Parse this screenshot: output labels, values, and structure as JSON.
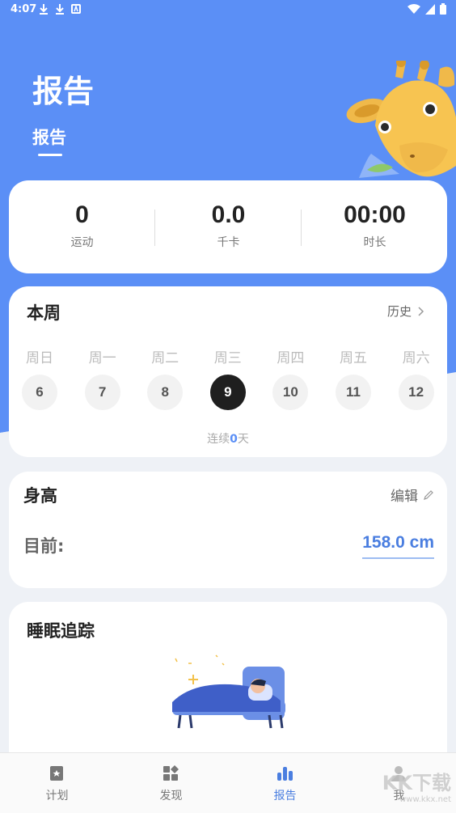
{
  "status_bar": {
    "time": "4:07"
  },
  "header": {
    "title": "报告",
    "tab": "报告"
  },
  "stats": [
    {
      "value": "0",
      "label": "运动"
    },
    {
      "value": "0.0",
      "label": "千卡"
    },
    {
      "value": "00:00",
      "label": "时长"
    }
  ],
  "week": {
    "title": "本周",
    "history_label": "历史",
    "days": [
      {
        "name": "周日",
        "date": "6"
      },
      {
        "name": "周一",
        "date": "7"
      },
      {
        "name": "周二",
        "date": "8"
      },
      {
        "name": "周三",
        "date": "9"
      },
      {
        "name": "周四",
        "date": "10"
      },
      {
        "name": "周五",
        "date": "11"
      },
      {
        "name": "周六",
        "date": "12"
      }
    ],
    "today_index": 3,
    "streak_prefix": "连续",
    "streak_value": "0",
    "streak_suffix": "天"
  },
  "height": {
    "title": "身高",
    "edit_label": "编辑",
    "current_label": "目前:",
    "value": "158.0 cm"
  },
  "sleep": {
    "title": "睡眠追踪"
  },
  "tabbar": [
    {
      "label": "计划",
      "icon": "bookmark-icon"
    },
    {
      "label": "发现",
      "icon": "grid-icon"
    },
    {
      "label": "报告",
      "icon": "bar-chart-icon"
    },
    {
      "label": "我",
      "icon": "user-icon"
    }
  ],
  "active_tab": 2,
  "watermark": {
    "text": "KK下载",
    "url": "www.kkx.net"
  },
  "colors": {
    "primary": "#5b8ff6",
    "accent": "#4a7ee0",
    "today": "#1f1f1f"
  }
}
